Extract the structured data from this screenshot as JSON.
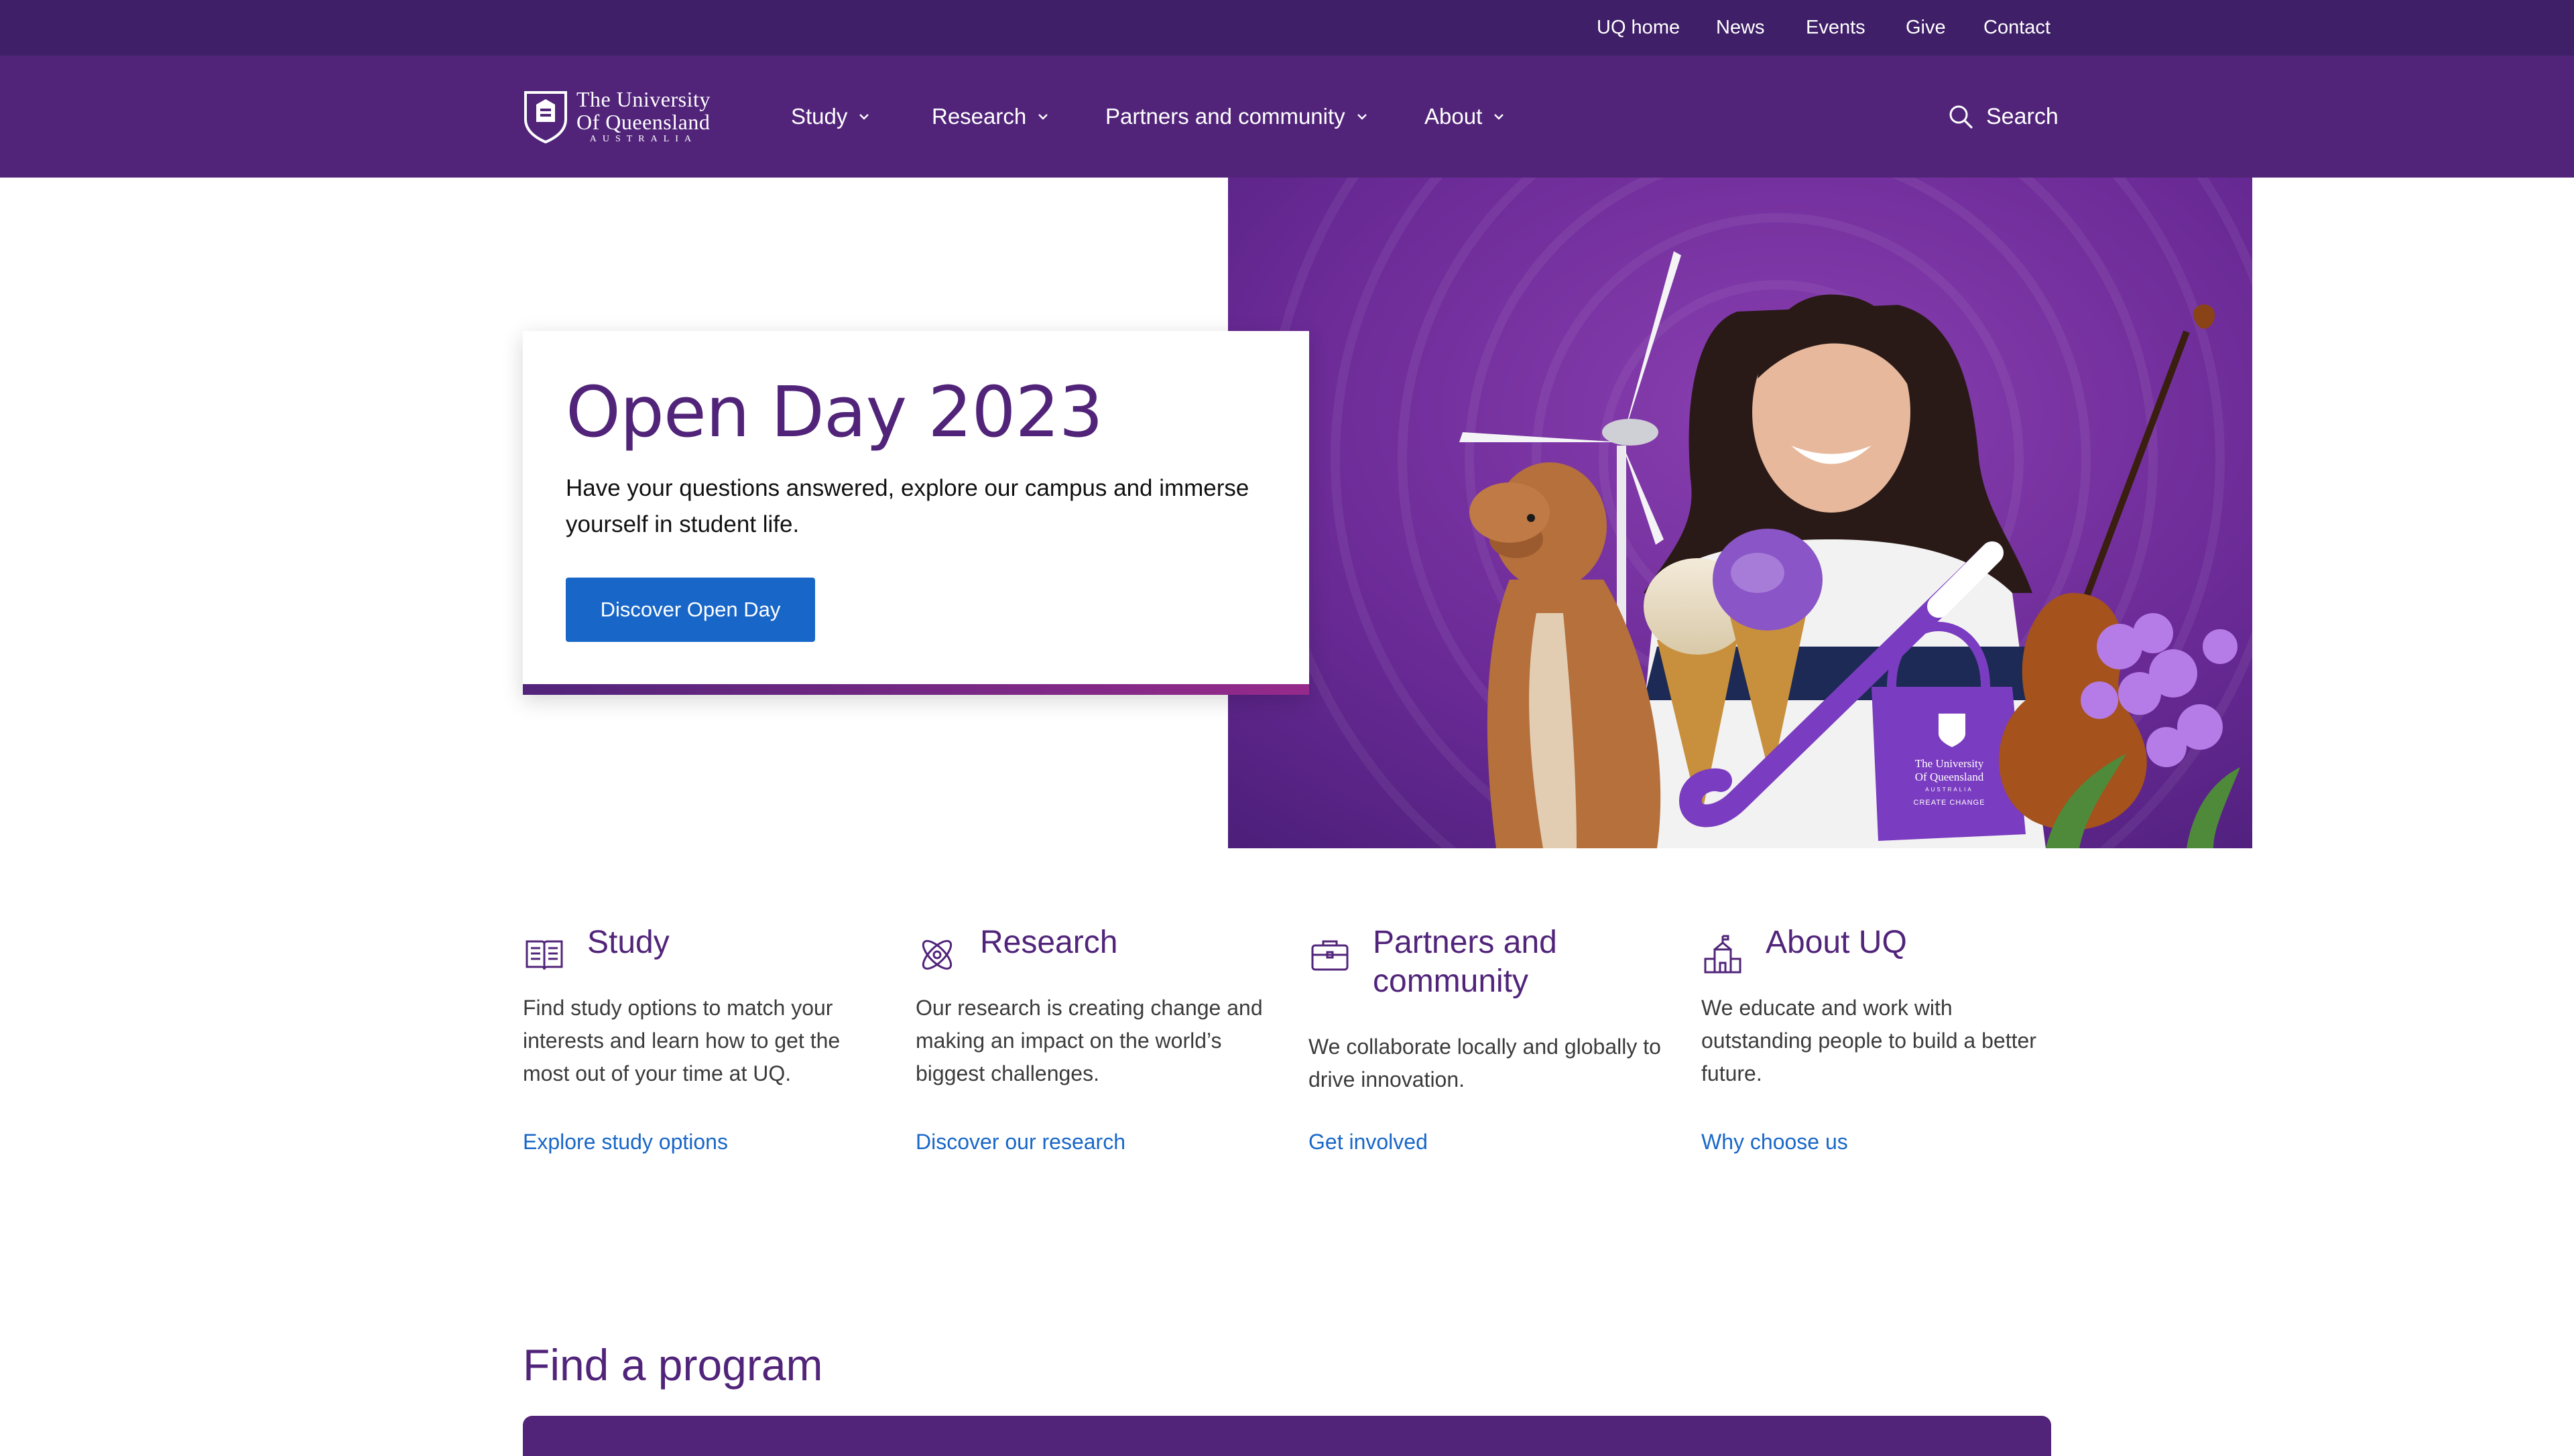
{
  "utility_nav": [
    "UQ home",
    "News",
    "Events",
    "Give",
    "Contact"
  ],
  "logo": {
    "line1": "The University",
    "line2": "Of Queensland",
    "line3": "AUSTRALIA"
  },
  "main_nav": [
    "Study",
    "Research",
    "Partners and community",
    "About"
  ],
  "search_label": "Search",
  "hero": {
    "title": "Open Day 2023",
    "text": "Have your questions answered, explore our campus and immerse yourself in student life.",
    "button": "Discover Open Day",
    "bag_text": {
      "l1": "The University",
      "l2": "Of Queensland",
      "l3": "AUSTRALIA",
      "l4": "CREATE CHANGE"
    }
  },
  "cards": [
    {
      "title": "Study",
      "text": "Find study options to match your interests and learn how to get the most out of your time at UQ.",
      "link": "Explore study options",
      "icon": "open-book-icon"
    },
    {
      "title": "Research",
      "text": "Our research is creating change and making an impact on the world’s biggest challenges.",
      "link": "Discover our research",
      "icon": "atom-icon"
    },
    {
      "title": "Partners and community",
      "text": "We collaborate locally and globally to drive innovation.",
      "link": "Get involved",
      "icon": "briefcase-icon"
    },
    {
      "title": "About UQ",
      "text": "We educate and work with outstanding people to build a better future.",
      "link": "Why choose us",
      "icon": "campus-building-icon"
    }
  ],
  "find_program": {
    "title": "Find a program"
  },
  "colors": {
    "purple_dark": "#3f2068",
    "purple": "#51247a",
    "link_blue": "#1867c8"
  }
}
